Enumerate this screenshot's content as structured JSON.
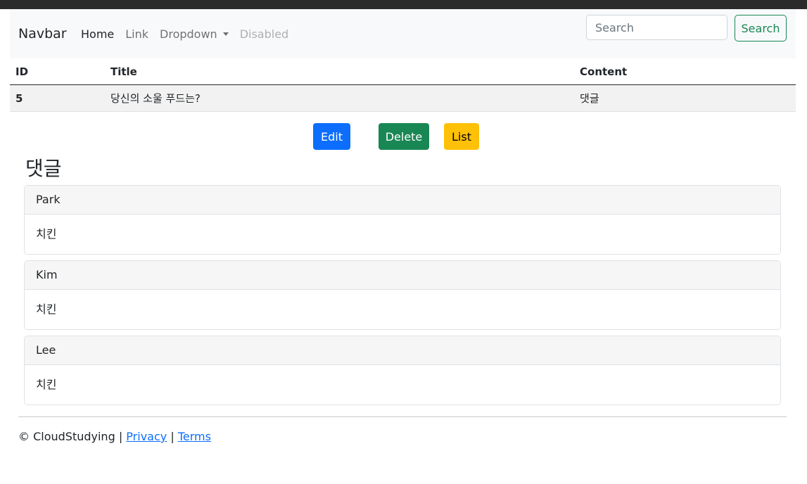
{
  "navbar": {
    "brand": "Navbar",
    "links": [
      {
        "label": "Home"
      },
      {
        "label": "Link"
      },
      {
        "label": "Dropdown"
      },
      {
        "label": "Disabled"
      }
    ],
    "search": {
      "placeholder": "Search",
      "button": "Search"
    }
  },
  "table": {
    "headers": [
      "ID",
      "Title",
      "Content"
    ],
    "row": {
      "id": "5",
      "title": "당신의 소울 푸드는?",
      "content": "댓글"
    }
  },
  "actions": {
    "edit": "Edit",
    "delete": "Delete",
    "list": "List"
  },
  "comments": {
    "title": "댓글",
    "items": [
      {
        "author": "Park",
        "text": "치킨"
      },
      {
        "author": "Kim",
        "text": "치킨"
      },
      {
        "author": "Lee",
        "text": "치킨"
      }
    ]
  },
  "footer": {
    "copyright": "© CloudStudying |",
    "privacy": "Privacy",
    "separator": "|",
    "terms": "Terms"
  },
  "colors": {
    "primary": "#0d6efd",
    "success": "#198754",
    "warning": "#ffc107",
    "navbar_bg": "#f8f9fa"
  }
}
